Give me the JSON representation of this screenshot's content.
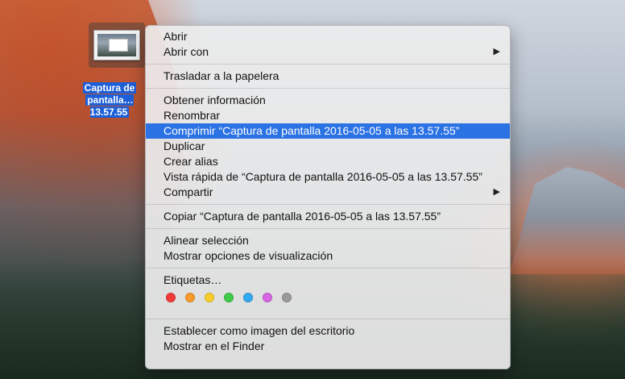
{
  "desktop": {
    "file": {
      "label_line1": "Captura de",
      "label_line2": "pantalla…13.57.55"
    }
  },
  "menu": {
    "groups": [
      [
        {
          "label": "Abrir"
        },
        {
          "label": "Abrir con",
          "submenu": true
        }
      ],
      [
        {
          "label": "Trasladar a la papelera"
        }
      ],
      [
        {
          "label": "Obtener información"
        },
        {
          "label": "Renombrar"
        },
        {
          "label": "Comprimir “Captura de pantalla 2016-05-05 a las 13.57.55”",
          "highlighted": true
        },
        {
          "label": "Duplicar"
        },
        {
          "label": "Crear alias"
        },
        {
          "label": "Vista rápida de “Captura de pantalla 2016-05-05 a las 13.57.55”"
        },
        {
          "label": "Compartir",
          "submenu": true
        }
      ],
      [
        {
          "label": "Copiar “Captura de pantalla 2016-05-05 a las 13.57.55”"
        }
      ],
      [
        {
          "label": "Alinear selección"
        },
        {
          "label": "Mostrar opciones de visualización"
        }
      ],
      [
        {
          "label": "Etiquetas…"
        }
      ],
      [
        {
          "label": "Establecer como imagen del escritorio"
        },
        {
          "label": "Mostrar en el Finder"
        }
      ]
    ],
    "tag_colors": [
      "#f23b37",
      "#f99a2b",
      "#f8cd2a",
      "#3ecb4a",
      "#34a8f3",
      "#d666e2",
      "#9a9a9a"
    ],
    "highlight_color": "#2b72e4"
  }
}
